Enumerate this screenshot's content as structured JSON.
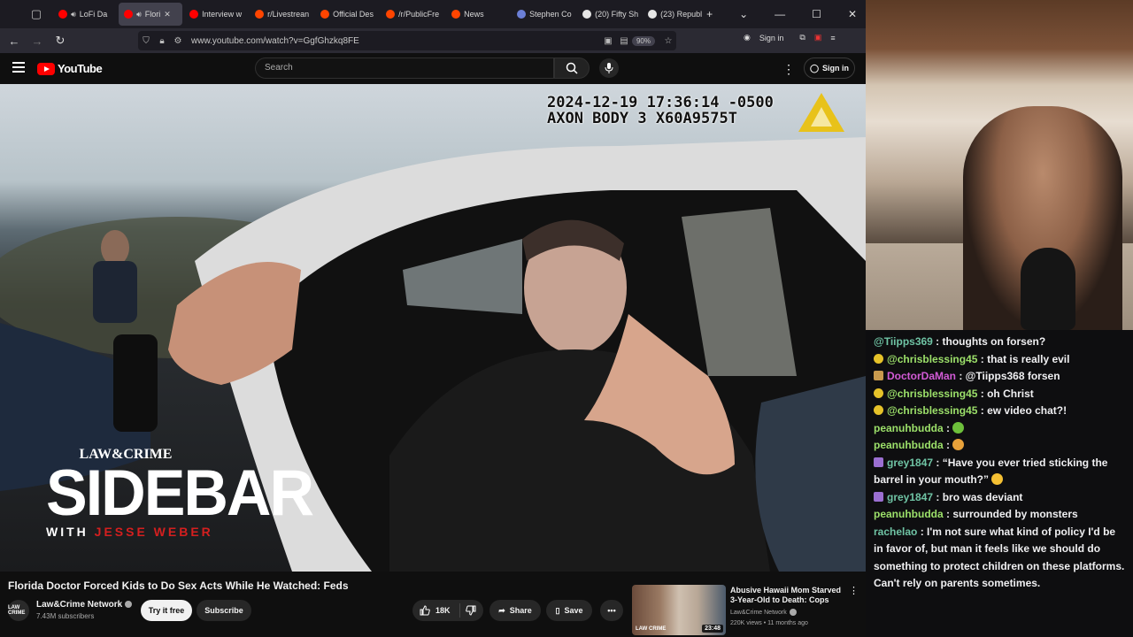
{
  "browser": {
    "tabs": [
      {
        "label": "LoFi Da",
        "color": "#ff0000",
        "audio": true,
        "active": false
      },
      {
        "label": "Flori",
        "color": "#ff0000",
        "audio": true,
        "active": true
      },
      {
        "label": "Interview w",
        "color": "#ff0000",
        "audio": false,
        "active": false
      },
      {
        "label": "r/Livestrean",
        "color": "#ff4500",
        "audio": false,
        "active": false
      },
      {
        "label": "Official Des",
        "color": "#ff4500",
        "audio": false,
        "active": false
      },
      {
        "label": "/r/PublicFre",
        "color": "#ff4500",
        "audio": false,
        "active": false
      },
      {
        "label": "News",
        "color": "#ff4500",
        "audio": false,
        "active": false
      },
      {
        "label": "Stephen Co",
        "color": "#6b7fd7",
        "audio": false,
        "active": false
      },
      {
        "label": "(20) Fifty Sh",
        "color": "#e6e6e6",
        "audio": false,
        "active": false
      },
      {
        "label": "(23) Republ",
        "color": "#e6e6e6",
        "audio": false,
        "active": false
      }
    ],
    "url": "www.youtube.com/watch?v=GgfGhzkq8FE",
    "zoom": "90%",
    "signin": "Sign in"
  },
  "youtube": {
    "logo_text": "YouTube",
    "search_placeholder": "Search",
    "signin": "Sign in"
  },
  "video": {
    "timestamp_line1": "2024-12-19 17:36:14 -0500",
    "timestamp_line2": "AXON BODY 3 X60A9575T",
    "overlay_brand": "LAW&CRIME",
    "overlay_title": "SIDEBAR",
    "overlay_with": "WITH",
    "overlay_host": "JESSE WEBER"
  },
  "watch": {
    "title": "Florida Doctor Forced Kids to Do Sex Acts While He Watched: Feds",
    "channel": "Law&Crime Network",
    "channel_avatar": "LAW CRIME",
    "subscribers": "7.43M subscribers",
    "try_free": "Try it free",
    "subscribe": "Subscribe",
    "likes": "18K",
    "share": "Share",
    "save": "Save"
  },
  "related": {
    "title": "Abusive Hawaii Mom Starved 3-Year-Old to Death: Cops",
    "channel": "Law&Crime Network",
    "meta": "220K views • 11 months ago",
    "duration": "23:48",
    "brand": "LAW CRIME"
  },
  "chat": [
    {
      "badge": null,
      "user": "@Tiipps369",
      "color": "#6fc3a4",
      "text": " : thoughts on forsen?"
    },
    {
      "badge": "#e6c229",
      "user": "@chrisblessing45",
      "color": "#9ce06a",
      "text": " : that is really evil"
    },
    {
      "badge": "#c99a4e",
      "user": "DoctorDaMan",
      "color": "#d25bd6",
      "text": " : @Tiipps368 forsen"
    },
    {
      "badge": "#e6c229",
      "user": "@chrisblessing45",
      "color": "#9ce06a",
      "text": " : oh Christ"
    },
    {
      "badge": "#e6c229",
      "user": "@chrisblessing45",
      "color": "#9ce06a",
      "text": " : ew video chat?!"
    },
    {
      "badge": null,
      "user": "peanuhbudda",
      "color": "#9ce06a",
      "text": " : ",
      "emote": "#6dbf3b"
    },
    {
      "badge": null,
      "user": "peanuhbudda",
      "color": "#9ce06a",
      "text": " : ",
      "emote": "#e8a13a"
    },
    {
      "badge": "#9b6fd1",
      "user": "grey1847",
      "color": "#6fc3a4",
      "text": " : “Have you ever tried sticking the barrel in your mouth?” ",
      "emote": "#f5c033"
    },
    {
      "badge": "#9b6fd1",
      "user": "grey1847",
      "color": "#6fc3a4",
      "text": " : bro was deviant"
    },
    {
      "badge": null,
      "user": "peanuhbudda",
      "color": "#9ce06a",
      "text": " : surrounded by monsters"
    },
    {
      "badge": null,
      "user": "rachelao",
      "color": "#6fc3a4",
      "text": " : I'm not sure what kind of policy I'd be in favor of, but man it feels like we should do something to protect children on these platforms. Can't rely on parents sometimes."
    }
  ]
}
